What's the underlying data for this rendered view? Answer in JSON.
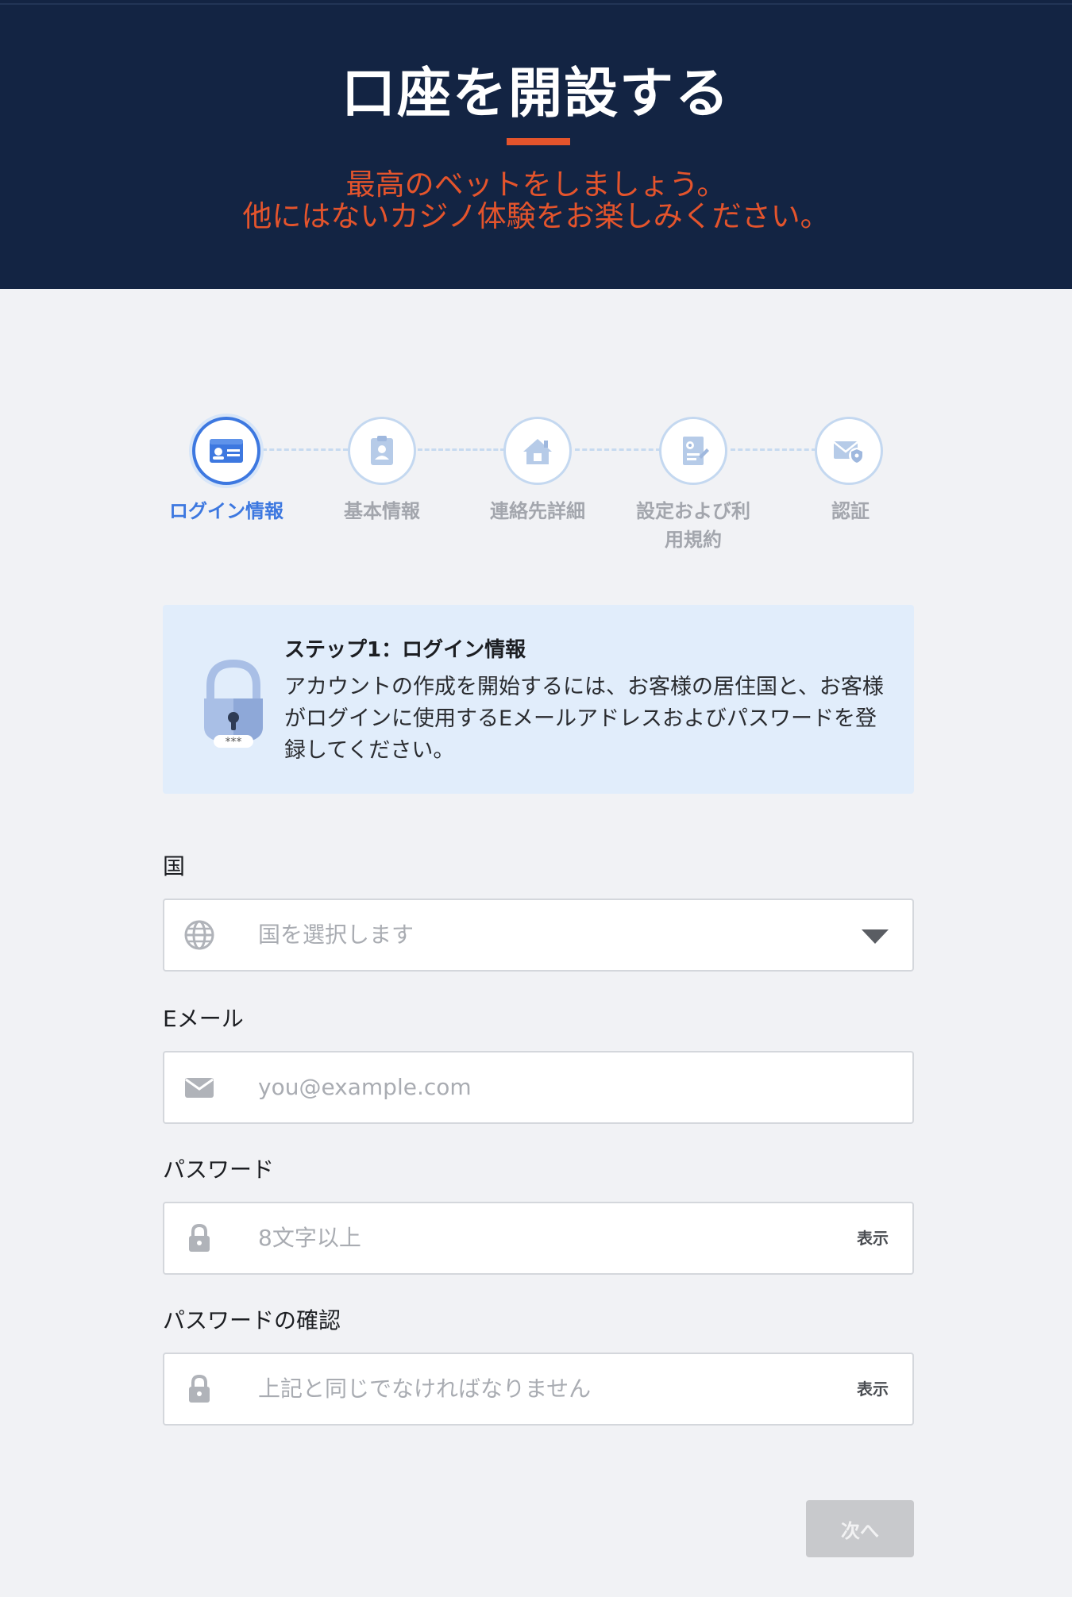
{
  "header": {
    "title": "口座を開設する",
    "subtitle_line1": "最高のベットをしましょう。",
    "subtitle_line2": "他にはないカジノ体験をお楽しみください。",
    "accent_color": "#e4542c",
    "background_color": "#132443"
  },
  "stepper": {
    "active_index": 0,
    "active_color": "#3d78e0",
    "steps": [
      {
        "label": "ログイン情報",
        "icon": "id-card-icon"
      },
      {
        "label": "基本情報",
        "icon": "clipboard-user-icon"
      },
      {
        "label": "連絡先詳細",
        "icon": "house-icon"
      },
      {
        "label_line1": "設定および利",
        "label_line2": "用規約",
        "icon": "document-settings-icon"
      },
      {
        "label": "認証",
        "icon": "envelope-shield-icon"
      }
    ]
  },
  "info_box": {
    "icon": "padlock-icon",
    "title": "ステップ1：ログイン情報",
    "text": "アカウントの作成を開始するには、お客様の居住国と、お客様がログインに使用するEメールアドレスおよびパスワードを登録してください。"
  },
  "form": {
    "country": {
      "label": "国",
      "placeholder": "国を選択します",
      "icon": "globe-icon"
    },
    "email": {
      "label": "Eメール",
      "placeholder": "you@example.com",
      "icon": "envelope-icon"
    },
    "password": {
      "label": "パスワード",
      "placeholder": "8文字以上",
      "icon": "lock-icon",
      "show_label": "表示"
    },
    "password_confirm": {
      "label": "パスワードの確認",
      "placeholder": "上記と同じでなければなりません",
      "icon": "lock-icon",
      "show_label": "表示"
    }
  },
  "next_button": {
    "label": "次へ"
  }
}
